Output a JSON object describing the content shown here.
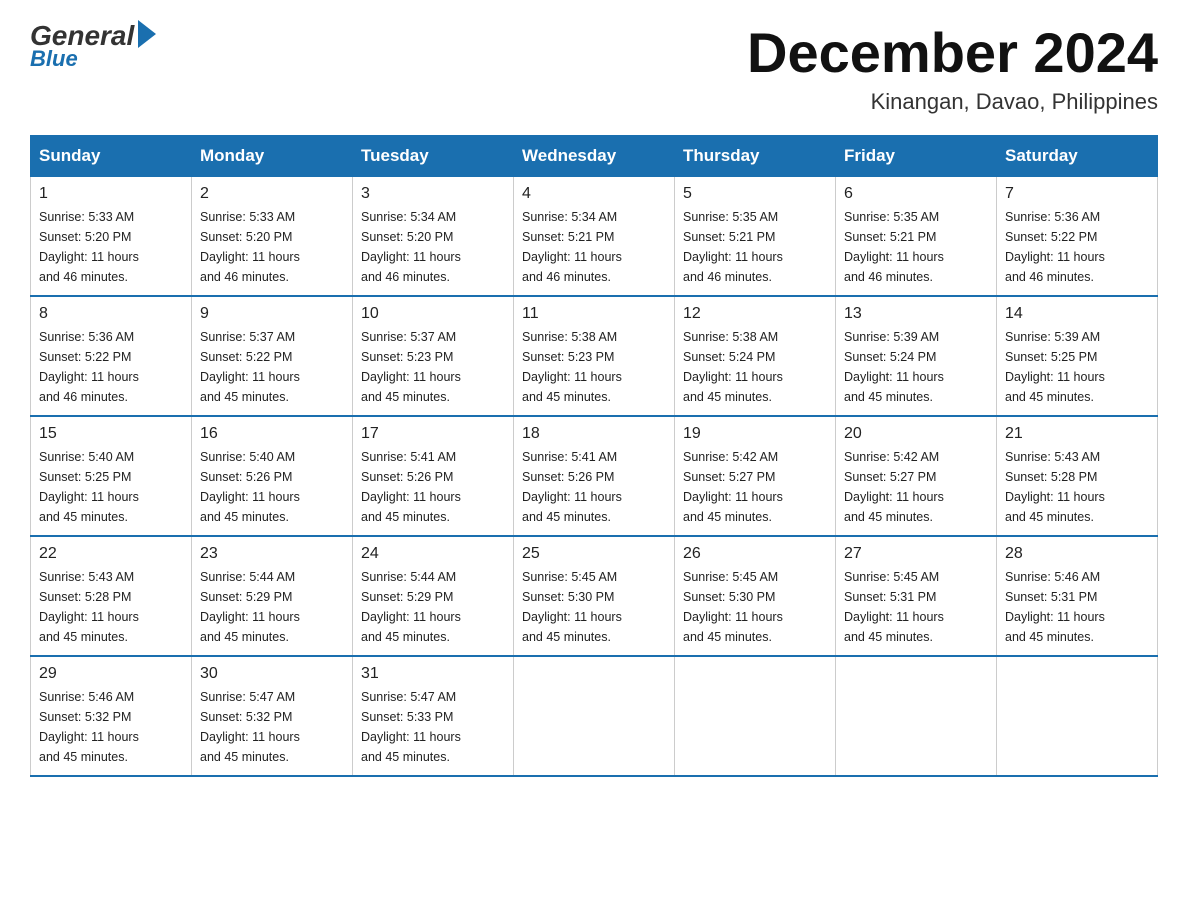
{
  "logo": {
    "general": "General",
    "blue": "Blue"
  },
  "header": {
    "month_year": "December 2024",
    "location": "Kinangan, Davao, Philippines"
  },
  "days_of_week": [
    "Sunday",
    "Monday",
    "Tuesday",
    "Wednesday",
    "Thursday",
    "Friday",
    "Saturday"
  ],
  "weeks": [
    [
      {
        "day": "1",
        "sunrise": "5:33 AM",
        "sunset": "5:20 PM",
        "daylight": "11 hours and 46 minutes."
      },
      {
        "day": "2",
        "sunrise": "5:33 AM",
        "sunset": "5:20 PM",
        "daylight": "11 hours and 46 minutes."
      },
      {
        "day": "3",
        "sunrise": "5:34 AM",
        "sunset": "5:20 PM",
        "daylight": "11 hours and 46 minutes."
      },
      {
        "day": "4",
        "sunrise": "5:34 AM",
        "sunset": "5:21 PM",
        "daylight": "11 hours and 46 minutes."
      },
      {
        "day": "5",
        "sunrise": "5:35 AM",
        "sunset": "5:21 PM",
        "daylight": "11 hours and 46 minutes."
      },
      {
        "day": "6",
        "sunrise": "5:35 AM",
        "sunset": "5:21 PM",
        "daylight": "11 hours and 46 minutes."
      },
      {
        "day": "7",
        "sunrise": "5:36 AM",
        "sunset": "5:22 PM",
        "daylight": "11 hours and 46 minutes."
      }
    ],
    [
      {
        "day": "8",
        "sunrise": "5:36 AM",
        "sunset": "5:22 PM",
        "daylight": "11 hours and 46 minutes."
      },
      {
        "day": "9",
        "sunrise": "5:37 AM",
        "sunset": "5:22 PM",
        "daylight": "11 hours and 45 minutes."
      },
      {
        "day": "10",
        "sunrise": "5:37 AM",
        "sunset": "5:23 PM",
        "daylight": "11 hours and 45 minutes."
      },
      {
        "day": "11",
        "sunrise": "5:38 AM",
        "sunset": "5:23 PM",
        "daylight": "11 hours and 45 minutes."
      },
      {
        "day": "12",
        "sunrise": "5:38 AM",
        "sunset": "5:24 PM",
        "daylight": "11 hours and 45 minutes."
      },
      {
        "day": "13",
        "sunrise": "5:39 AM",
        "sunset": "5:24 PM",
        "daylight": "11 hours and 45 minutes."
      },
      {
        "day": "14",
        "sunrise": "5:39 AM",
        "sunset": "5:25 PM",
        "daylight": "11 hours and 45 minutes."
      }
    ],
    [
      {
        "day": "15",
        "sunrise": "5:40 AM",
        "sunset": "5:25 PM",
        "daylight": "11 hours and 45 minutes."
      },
      {
        "day": "16",
        "sunrise": "5:40 AM",
        "sunset": "5:26 PM",
        "daylight": "11 hours and 45 minutes."
      },
      {
        "day": "17",
        "sunrise": "5:41 AM",
        "sunset": "5:26 PM",
        "daylight": "11 hours and 45 minutes."
      },
      {
        "day": "18",
        "sunrise": "5:41 AM",
        "sunset": "5:26 PM",
        "daylight": "11 hours and 45 minutes."
      },
      {
        "day": "19",
        "sunrise": "5:42 AM",
        "sunset": "5:27 PM",
        "daylight": "11 hours and 45 minutes."
      },
      {
        "day": "20",
        "sunrise": "5:42 AM",
        "sunset": "5:27 PM",
        "daylight": "11 hours and 45 minutes."
      },
      {
        "day": "21",
        "sunrise": "5:43 AM",
        "sunset": "5:28 PM",
        "daylight": "11 hours and 45 minutes."
      }
    ],
    [
      {
        "day": "22",
        "sunrise": "5:43 AM",
        "sunset": "5:28 PM",
        "daylight": "11 hours and 45 minutes."
      },
      {
        "day": "23",
        "sunrise": "5:44 AM",
        "sunset": "5:29 PM",
        "daylight": "11 hours and 45 minutes."
      },
      {
        "day": "24",
        "sunrise": "5:44 AM",
        "sunset": "5:29 PM",
        "daylight": "11 hours and 45 minutes."
      },
      {
        "day": "25",
        "sunrise": "5:45 AM",
        "sunset": "5:30 PM",
        "daylight": "11 hours and 45 minutes."
      },
      {
        "day": "26",
        "sunrise": "5:45 AM",
        "sunset": "5:30 PM",
        "daylight": "11 hours and 45 minutes."
      },
      {
        "day": "27",
        "sunrise": "5:45 AM",
        "sunset": "5:31 PM",
        "daylight": "11 hours and 45 minutes."
      },
      {
        "day": "28",
        "sunrise": "5:46 AM",
        "sunset": "5:31 PM",
        "daylight": "11 hours and 45 minutes."
      }
    ],
    [
      {
        "day": "29",
        "sunrise": "5:46 AM",
        "sunset": "5:32 PM",
        "daylight": "11 hours and 45 minutes."
      },
      {
        "day": "30",
        "sunrise": "5:47 AM",
        "sunset": "5:32 PM",
        "daylight": "11 hours and 45 minutes."
      },
      {
        "day": "31",
        "sunrise": "5:47 AM",
        "sunset": "5:33 PM",
        "daylight": "11 hours and 45 minutes."
      },
      null,
      null,
      null,
      null
    ]
  ],
  "labels": {
    "sunrise": "Sunrise:",
    "sunset": "Sunset:",
    "daylight": "Daylight:"
  }
}
